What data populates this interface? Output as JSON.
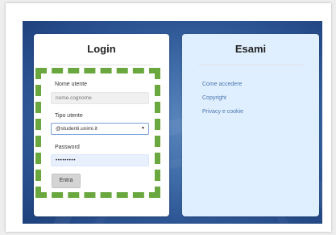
{
  "login": {
    "title": "Login",
    "username": {
      "label": "Nome utente",
      "placeholder": "nome.cognome"
    },
    "user_type": {
      "label": "Tipo utente",
      "selected": "@studenti.unimi.it"
    },
    "password": {
      "label": "Password",
      "value": "•••••••••"
    },
    "submit_label": "Entra"
  },
  "exams": {
    "title": "Esami",
    "links": [
      "Come accedere",
      "Copyright",
      "Privacy e cookie"
    ]
  },
  "colors": {
    "highlight": "#6aa83f",
    "link": "#4a76ad",
    "background": "#2a5190"
  },
  "icons": {
    "select_arrow": "▼"
  }
}
